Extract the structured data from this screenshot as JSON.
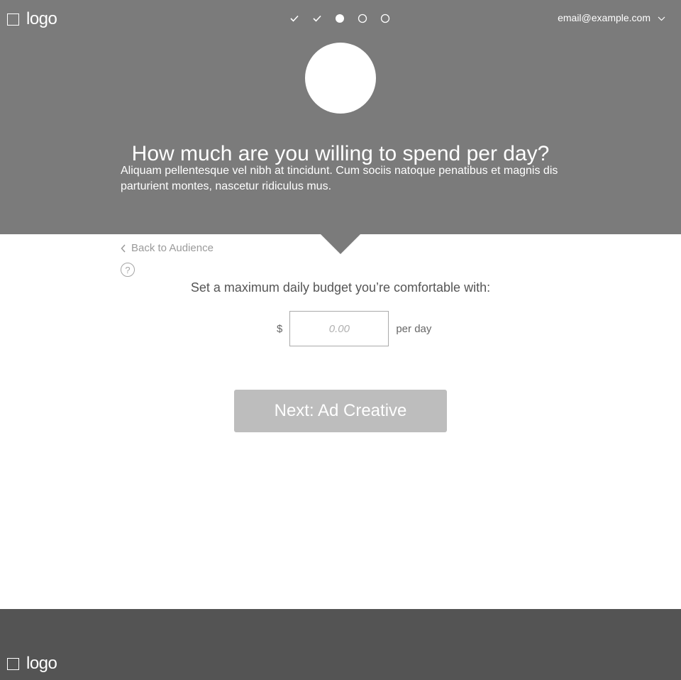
{
  "header": {
    "logo_text": "logo",
    "account_email": "email@example.com",
    "steps": [
      {
        "state": "complete",
        "icon": "check-icon"
      },
      {
        "state": "complete",
        "icon": "check-icon"
      },
      {
        "state": "current",
        "icon": "filled-dot-icon"
      },
      {
        "state": "upcoming",
        "icon": "empty-dot-icon"
      },
      {
        "state": "upcoming",
        "icon": "empty-dot-icon"
      }
    ]
  },
  "hero": {
    "title": "How much are you willing to spend per day?",
    "subtitle": "Aliquam pellentesque vel nibh at tincidunt. Cum sociis natoque penatibus et magnis dis parturient montes, nascetur ridiculus mus."
  },
  "main": {
    "back_label": "Back to Audience",
    "help_symbol": "?",
    "prompt": "Set a maximum daily budget you’re comfortable with:",
    "currency_symbol": "$",
    "budget_value": "",
    "budget_placeholder": "0.00",
    "unit_label": "per day",
    "next_label": "Next: Ad Creative"
  },
  "footer": {
    "logo_text": "logo"
  },
  "colors": {
    "hero_bg": "#7b7b7b",
    "footer_bg": "#545454",
    "button_bg": "#bdbdbd"
  }
}
